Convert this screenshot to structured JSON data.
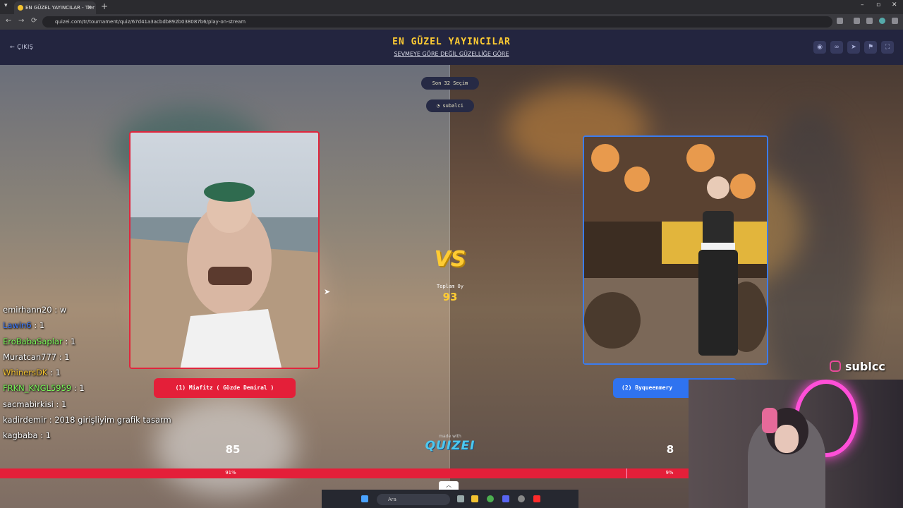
{
  "browser": {
    "tab_title": "EN GÜZEL YAYINCILAR - Tier Li",
    "url": "quizei.com/tr/tournament/quiz/67d41a3acbdb892b038087b6/play-on-stream"
  },
  "header": {
    "back_label": "ÇIKIŞ",
    "title": "EN GÜZEL YAYINCILAR",
    "subtitle": "SEVMEYE GÖRE DEĞİL GÜZELLİĞE GÖRE",
    "icons": [
      "eye-icon",
      "link-icon",
      "share-icon",
      "flag-icon",
      "fullscreen-icon"
    ]
  },
  "round": {
    "label": "Son 32 Seçim",
    "author": "subalci"
  },
  "contestants": {
    "left": {
      "name": "(1) Miafitz ( Gözde Demiral )",
      "votes": "85",
      "percent": "91%",
      "share": 0.91,
      "color": "#e41f39"
    },
    "right": {
      "name": "(2) Byqueenmery",
      "votes": "8",
      "percent": "9%",
      "share": 0.09,
      "color": "#2f73f0"
    }
  },
  "center": {
    "vs": "VS",
    "total_label": "Toplam Oy",
    "total_value": "93",
    "made_with": "made with",
    "brand": "QUIZEI"
  },
  "overlay": {
    "instagram": "sublcc"
  },
  "chat": [
    {
      "user": "emirhann20",
      "text": ": w",
      "color": "#ffffff"
    },
    {
      "user": "Lawin6",
      "text": ": 1",
      "color": "#3d7bff"
    },
    {
      "user": "EroBabaSaplar",
      "text": ": 1",
      "color": "#7cfc5a"
    },
    {
      "user": "Muratcan777",
      "text": ": 1",
      "color": "#ffffff"
    },
    {
      "user": "WhinersDK",
      "text": ": 1",
      "color": "#f2c230"
    },
    {
      "user": "FRKN_KNGL5959",
      "text": ": 1",
      "color": "#7cfc5a"
    },
    {
      "user": "sacmabirkisi",
      "text": ": 1",
      "color": "#ffffff"
    },
    {
      "user": "kadirdemir",
      "text": ": 2018 girişliyim grafik tasarm",
      "color": "#ffffff"
    },
    {
      "user": "kagbaba",
      "text": ": 1",
      "color": "#ffffff"
    }
  ],
  "taskbar": {
    "search_placeholder": "Ara"
  }
}
